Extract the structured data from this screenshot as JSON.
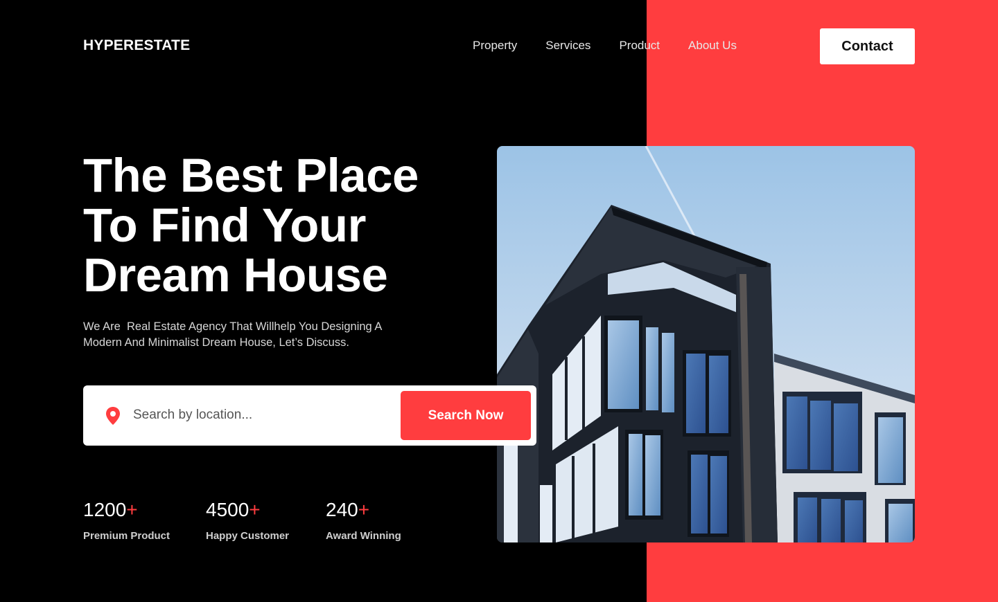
{
  "brand": {
    "logo_text": "HYPERESTATE"
  },
  "nav": {
    "items": [
      {
        "label": "Property"
      },
      {
        "label": "Services"
      },
      {
        "label": "Product"
      },
      {
        "label": "About Us"
      }
    ],
    "contact_label": "Contact"
  },
  "hero": {
    "title_lines": [
      "The Best Place",
      "To Find Your",
      "Dream House"
    ],
    "description_lines": [
      "We Are  Real Estate Agency That Willhelp You Designing A",
      "Modern And Minimalist Dream House, Let’s Discuss."
    ]
  },
  "search": {
    "icon": "location-pin-icon",
    "placeholder": "Search by location...",
    "value": "",
    "button_label": "Search Now"
  },
  "stats": [
    {
      "number": "1200",
      "suffix": "+",
      "label": "Premium Product"
    },
    {
      "number": "4500",
      "suffix": "+",
      "label": "Happy Customer"
    },
    {
      "number": "240",
      "suffix": "+",
      "label": "Award Winning"
    }
  ],
  "colors": {
    "background": "#000000",
    "accent": "#ff3d3f",
    "text": "#ffffff",
    "button_light": "#ffffff"
  }
}
